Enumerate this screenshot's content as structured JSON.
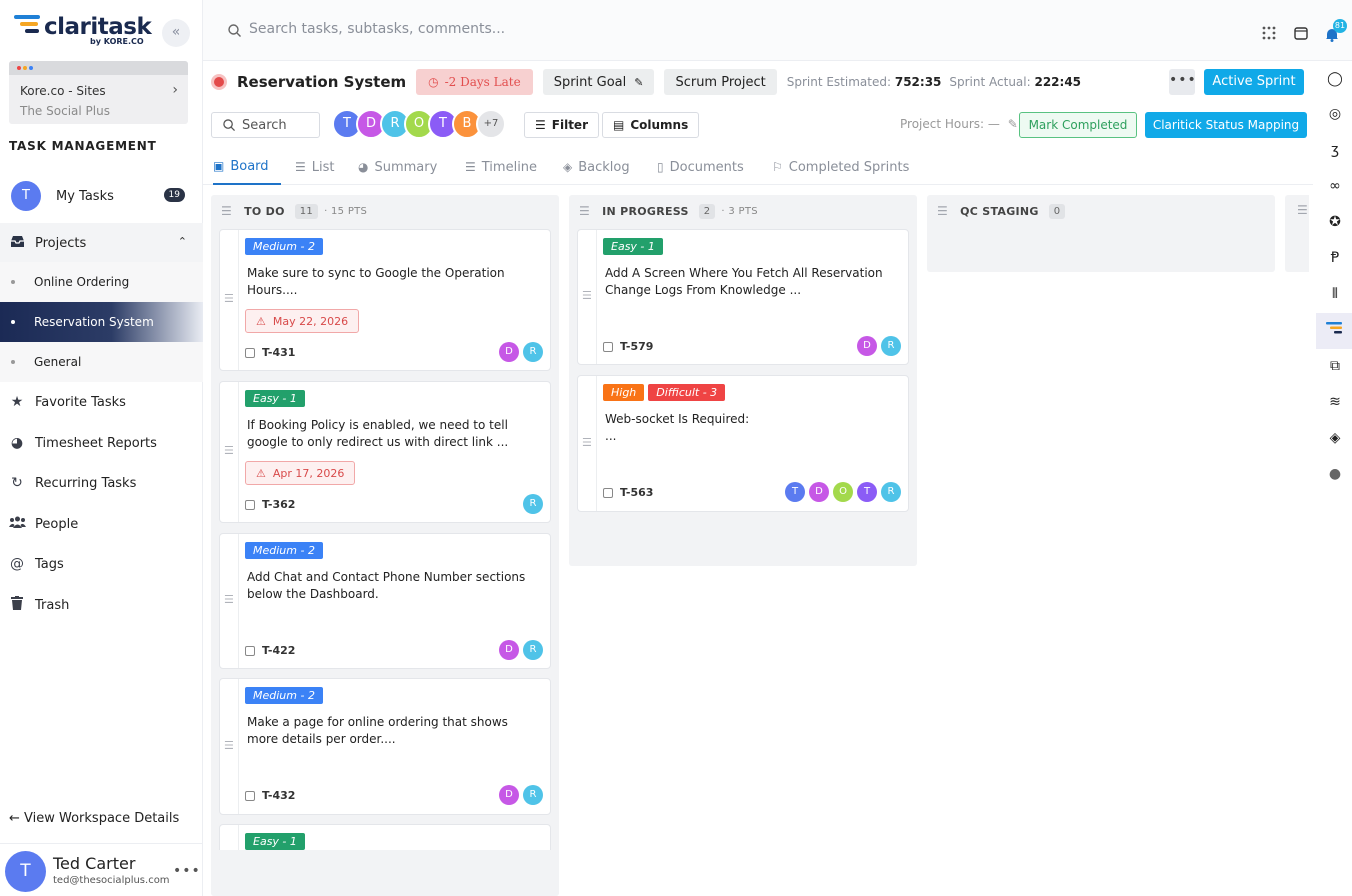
{
  "brand": {
    "name": "claritask",
    "byline": "by KORE.CO"
  },
  "workspace": {
    "name": "Kore.co - Sites",
    "sub": "The Social Plus"
  },
  "sidebar": {
    "section_title": "TASK MANAGEMENT",
    "my_tasks": {
      "label": "My Tasks",
      "avatar": "T",
      "count": "19"
    },
    "projects_label": "Projects",
    "projects": [
      "Online Ordering",
      "Reservation System",
      "General"
    ],
    "items": [
      "Favorite Tasks",
      "Timesheet Reports",
      "Recurring Tasks",
      "People",
      "Tags",
      "Trash"
    ],
    "view_workspace": "← View Workspace Details"
  },
  "user": {
    "avatar": "T",
    "name": "Ted Carter",
    "email": "ted@thesocialplus.com"
  },
  "topbar": {
    "search_placeholder": "Search tasks, subtasks, comments...",
    "notifications": "81"
  },
  "project": {
    "title": "Reservation System",
    "late": "-2 Days Late",
    "sprint_goal": "Sprint Goal",
    "scrum": "Scrum Project",
    "estimated_label": "Sprint Estimated:",
    "estimated_value": "752:35",
    "actual_label": "Sprint Actual:",
    "actual_value": "222:45",
    "active_sprint": "Active Sprint"
  },
  "toolbar": {
    "search": "Search",
    "avatars": [
      "T",
      "D",
      "R",
      "O",
      "T",
      "B"
    ],
    "avatar_more": "+7",
    "filter": "Filter",
    "columns": "Columns",
    "project_hours": "Project Hours: —",
    "mark_completed": "Mark Completed",
    "status_mapping": "Claritick Status Mapping"
  },
  "tabs": [
    "Board",
    "List",
    "Summary",
    "Timeline",
    "Backlog",
    "Documents",
    "Completed Sprints"
  ],
  "columns": [
    {
      "name": "TO DO",
      "count": "11",
      "pts": "· 15 PTS",
      "cards": [
        {
          "tags": [
            "Medium - 2"
          ],
          "title": "Make sure to sync to Google the Operation Hours....",
          "due": "May 22, 2026",
          "id": "T-431",
          "avatars": [
            "D",
            "R"
          ]
        },
        {
          "tags": [
            "Easy - 1"
          ],
          "title": "If Booking Policy is enabled, we need to tell google to only redirect us with direct link ...",
          "due": "Apr 17, 2026",
          "id": "T-362",
          "avatars": [
            "R"
          ]
        },
        {
          "tags": [
            "Medium - 2"
          ],
          "title": "Add Chat and Contact Phone Number sections below the Dashboard.",
          "due": "",
          "id": "T-422",
          "avatars": [
            "D",
            "R"
          ]
        },
        {
          "tags": [
            "Medium - 2"
          ],
          "title": "Make a page for online ordering that shows more details per order....",
          "due": "",
          "id": "T-432",
          "avatars": [
            "D",
            "R"
          ]
        },
        {
          "tags": [
            "Easy - 1"
          ],
          "title": "",
          "due": "",
          "id": "",
          "avatars": []
        }
      ]
    },
    {
      "name": "IN PROGRESS",
      "count": "2",
      "pts": "· 3 PTS",
      "cards": [
        {
          "tags": [
            "Easy - 1"
          ],
          "title": "Add A Screen Where You Fetch All Reservation Change Logs From Knowledge ...",
          "due": "",
          "id": "T-579",
          "avatars": [
            "D",
            "R"
          ]
        },
        {
          "tags": [
            "High",
            "Difficult - 3"
          ],
          "title": "Web-socket Is Required:\n...",
          "due": "",
          "id": "T-563",
          "avatars": [
            "T",
            "D",
            "O",
            "T",
            "R"
          ]
        }
      ]
    },
    {
      "name": "QC STAGING",
      "count": "0",
      "pts": "",
      "cards": []
    }
  ],
  "colors": {
    "accent": "#10a9e8",
    "navy": "#1b2a55",
    "tag_medium": "#3b82f6",
    "tag_easy": "#22a06b",
    "tag_high": "#f97316",
    "tag_difficult": "#ef4444",
    "late": "#e24e4e"
  }
}
